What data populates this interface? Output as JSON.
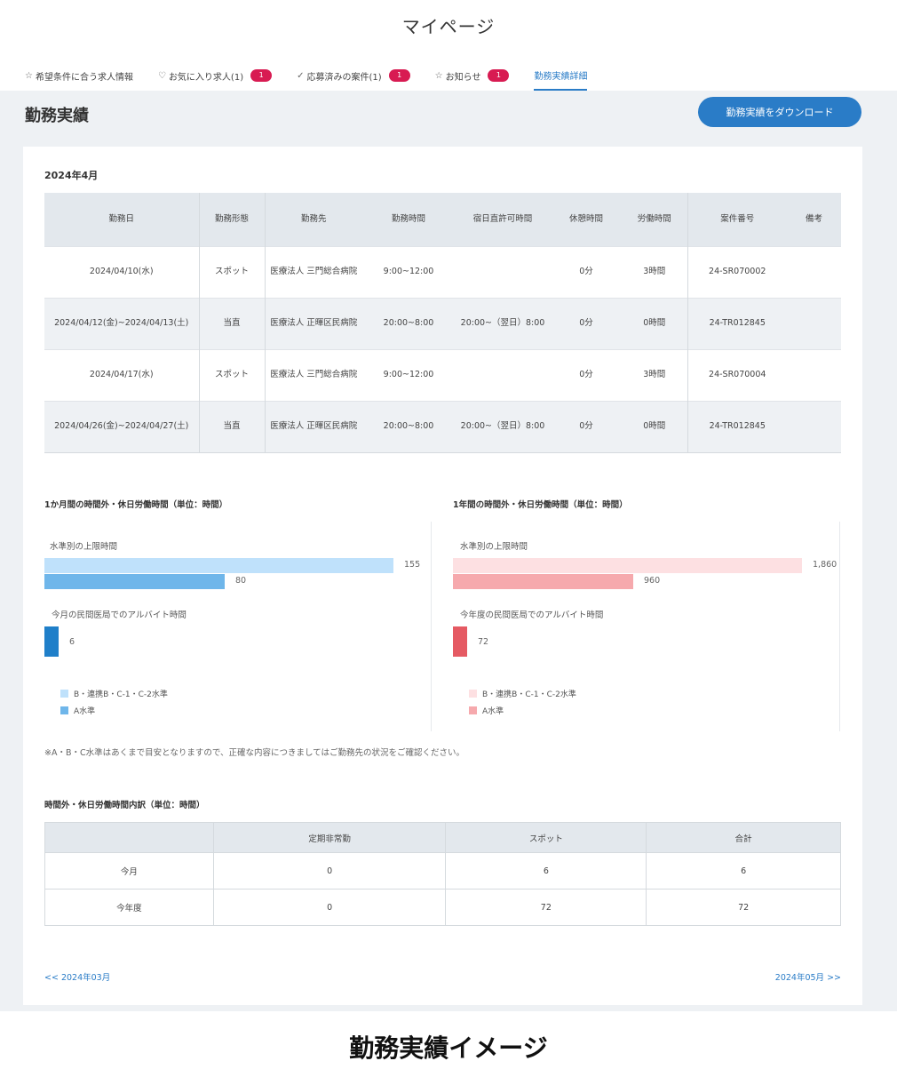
{
  "header": {
    "title": "マイページ"
  },
  "tabs": [
    {
      "icon": "☆",
      "icon_name": "star-icon",
      "label": "希望条件に合う求人情報",
      "badge": ""
    },
    {
      "icon": "♡",
      "icon_name": "heart-icon",
      "label": "お気に入り求人(1)",
      "badge": "1"
    },
    {
      "icon": "✓",
      "icon_name": "check-icon",
      "label": "応募済みの案件(1)",
      "badge": "1"
    },
    {
      "icon": "☆",
      "icon_name": "bell-icon",
      "label": "お知らせ",
      "badge": "1"
    },
    {
      "icon": "",
      "icon_name": "",
      "label": "勤務実績詳細",
      "badge": ""
    }
  ],
  "section": {
    "title": "勤務実績",
    "download_label": "勤務実績をダウンロード"
  },
  "month_label": "2024年4月",
  "work_table": {
    "headers": [
      "勤務日",
      "勤務形態",
      "勤務先",
      "勤務時間",
      "宿日直許可時間",
      "休憩時間",
      "労働時間",
      "案件番号",
      "備考"
    ],
    "rows": [
      [
        "2024/04/10(水)",
        "スポット",
        "医療法人 三門総合病院",
        "9:00~12:00",
        "",
        "0分",
        "3時間",
        "24-SR070002",
        ""
      ],
      [
        "2024/04/12(金)~2024/04/13(土)",
        "当直",
        "医療法人 正暉区民病院",
        "20:00~8:00",
        "20:00~（翌日）8:00",
        "0分",
        "0時間",
        "24-TR012845",
        ""
      ],
      [
        "2024/04/17(水)",
        "スポット",
        "医療法人 三門総合病院",
        "9:00~12:00",
        "",
        "0分",
        "3時間",
        "24-SR070004",
        ""
      ],
      [
        "2024/04/26(金)~2024/04/27(土)",
        "当直",
        "医療法人 正暉区民病院",
        "20:00~8:00",
        "20:00~（翌日）8:00",
        "0分",
        "0時間",
        "24-TR012845",
        ""
      ]
    ]
  },
  "charts": {
    "left_title": "1か月間の時間外・休日労働時間（単位：時間）",
    "right_title": "1年間の時間外・休日労働時間（単位：時間）"
  },
  "chart_data": [
    {
      "type": "bar",
      "title": "1か月間の時間外・休日労働時間（単位：時間）",
      "groups": [
        {
          "label": "水準別の上限時間",
          "bars": [
            {
              "series": "B・連携B・C-1・C-2水準",
              "value": 155
            },
            {
              "series": "A水準",
              "value": 80
            }
          ]
        },
        {
          "label": "今月の民間医局でのアルバイト時間",
          "bars": [
            {
              "series": "actual",
              "value": 6
            }
          ]
        }
      ],
      "value_labels": [
        "155",
        "80",
        "6"
      ],
      "legend": [
        "B・連携B・C-1・C-2水準",
        "A水準"
      ],
      "colors": [
        "#bfe1fb",
        "#6fb6ea",
        "#1f7fc9"
      ],
      "xlim": [
        0,
        155
      ]
    },
    {
      "type": "bar",
      "title": "1年間の時間外・休日労働時間（単位：時間）",
      "groups": [
        {
          "label": "水準別の上限時間",
          "bars": [
            {
              "series": "B・連携B・C-1・C-2水準",
              "value": 1860
            },
            {
              "series": "A水準",
              "value": 960
            }
          ]
        },
        {
          "label": "今年度の民間医局でのアルバイト時間",
          "bars": [
            {
              "series": "actual",
              "value": 72
            }
          ]
        }
      ],
      "value_labels": [
        "1,860",
        "960",
        "72"
      ],
      "legend": [
        "B・連携B・C-1・C-2水準",
        "A水準"
      ],
      "colors": [
        "#fde0e2",
        "#f6a9ad",
        "#e55a63"
      ],
      "xlim": [
        0,
        1860
      ]
    }
  ],
  "note": "※A・B・C水準はあくまで目安となりますので、正確な内容につきましてはご勤務先の状況をご確認ください。",
  "breakdown": {
    "title": "時間外・休日労働時間内訳（単位：時間）",
    "headers": [
      "",
      "定期非常勤",
      "スポット",
      "合計"
    ],
    "rows": [
      [
        "今月",
        "0",
        "6",
        "6"
      ],
      [
        "今年度",
        "0",
        "72",
        "72"
      ]
    ]
  },
  "pager": {
    "prev": "<< 2024年03月",
    "next": "2024年05月 >>"
  },
  "caption": "勤務実績イメージ"
}
